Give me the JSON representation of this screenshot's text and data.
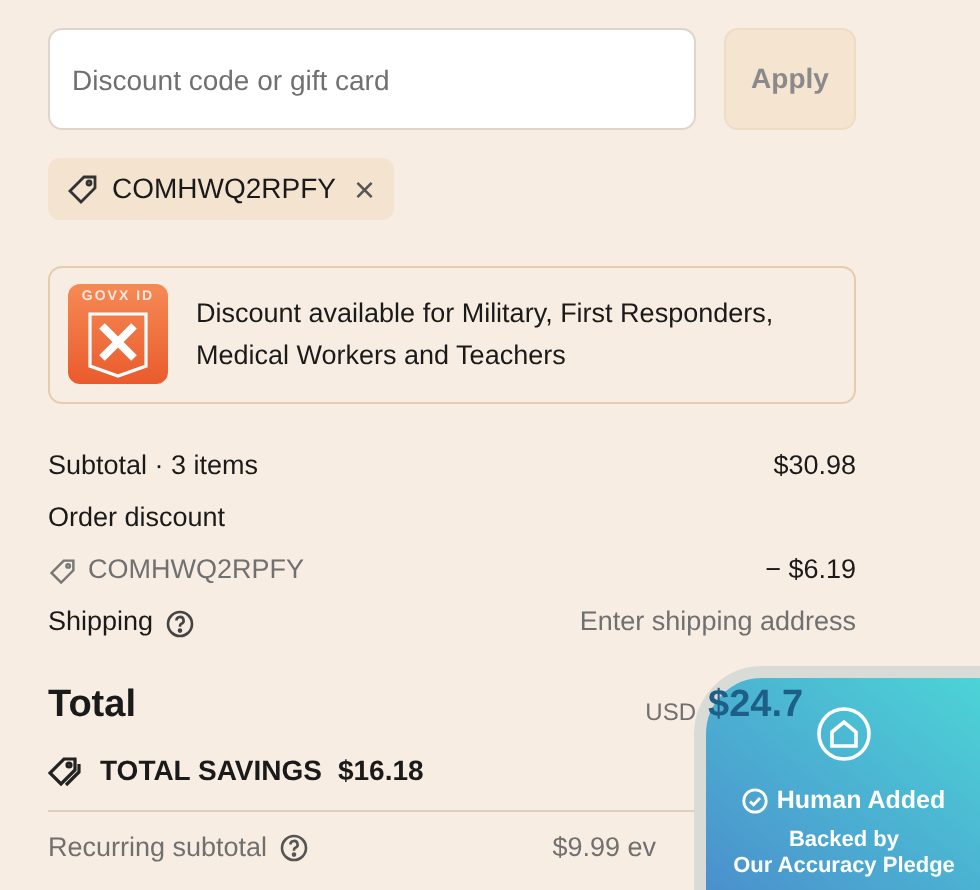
{
  "discount_field": {
    "placeholder": "Discount code or gift card"
  },
  "apply_button": {
    "label": "Apply",
    "disabled": true
  },
  "applied_code": {
    "code": "COMHWQ2RPFY",
    "remove": "×"
  },
  "govx_banner": {
    "logo_text": "GOVX ID",
    "message": "Discount available for Military, First Responders, Medical Workers and Teachers"
  },
  "summary": [
    {
      "kind": "line",
      "label": "Subtotal · 3 items",
      "value": "$30.98"
    },
    {
      "kind": "heading",
      "label": "Order discount"
    },
    {
      "kind": "code",
      "label": "COMHWQ2RPFY",
      "value": "− $6.19"
    },
    {
      "kind": "help",
      "label": "Shipping",
      "value": "Enter shipping address"
    }
  ],
  "total": {
    "label": "Total",
    "currency": "USD",
    "amount": "$24.7"
  },
  "savings": {
    "label": "TOTAL SAVINGS",
    "amount": "$16.18"
  },
  "recurring": {
    "label": "Recurring subtotal",
    "value": "$9.99 ev"
  },
  "badge": {
    "title": "Human Added",
    "subtitle_1": "Backed by",
    "subtitle_2": "Our Accuracy Pledge"
  }
}
